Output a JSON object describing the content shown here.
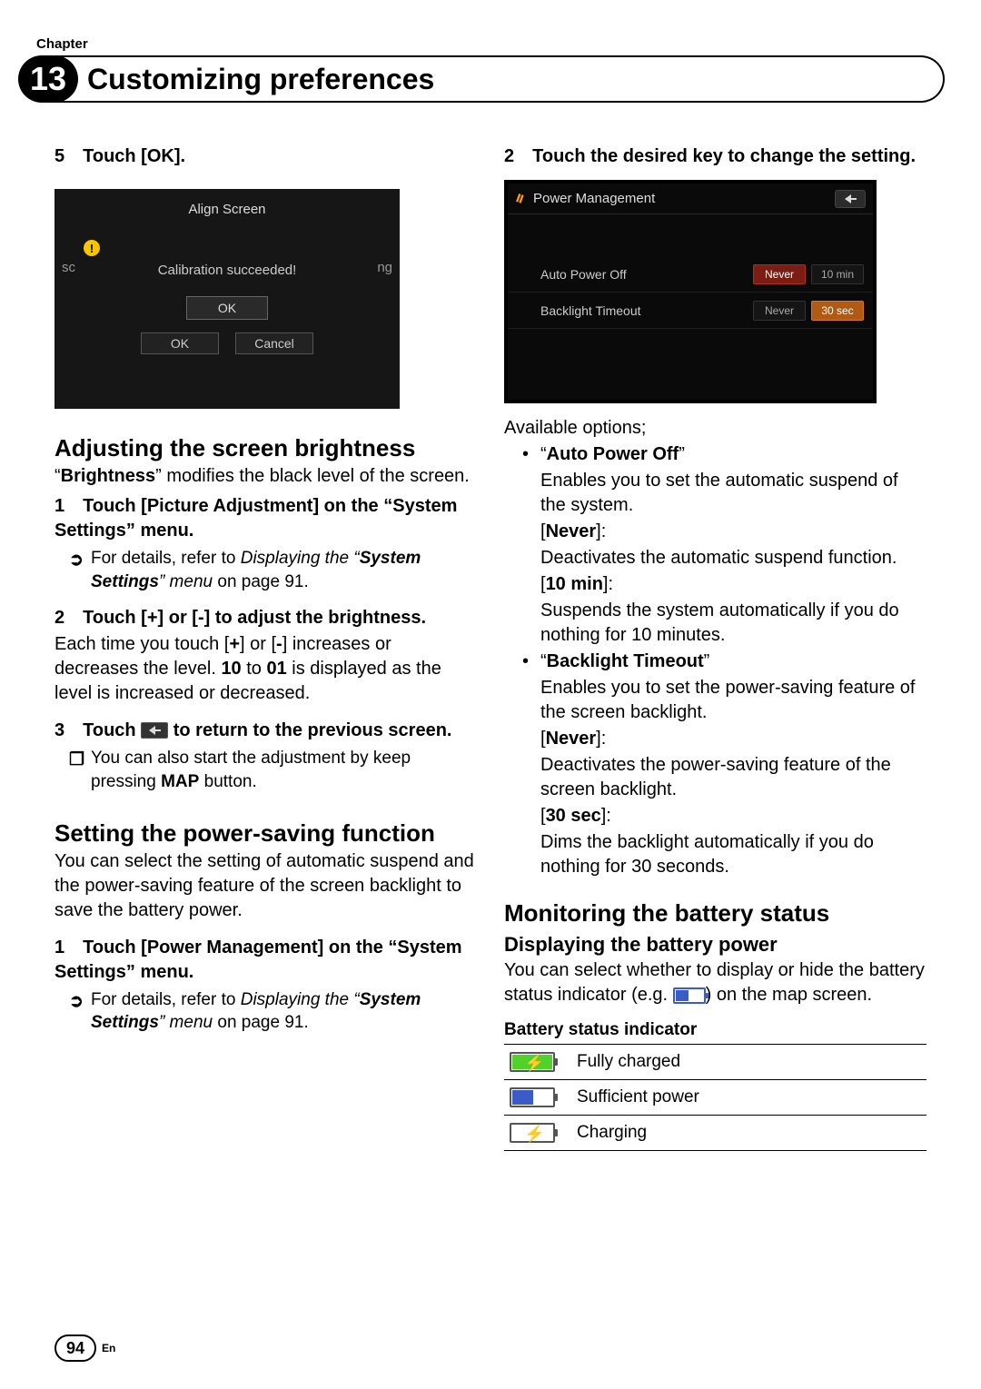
{
  "chapter_label": "Chapter",
  "chapter_num": "13",
  "chapter_title": "Customizing preferences",
  "page_num": "94",
  "lang": "En",
  "left": {
    "step5": "5 Touch [OK].",
    "shot1": {
      "title": "Align Screen",
      "left": "sc",
      "right": "ng",
      "msg": "Calibration succeeded!",
      "ok": "OK",
      "ok2": "OK",
      "cancel": "Cancel"
    },
    "h_brightness": "Adjusting the screen brightness",
    "p_brightness_1a": "“",
    "p_brightness_1b": "Brightness",
    "p_brightness_1c": "” modifies the black level of the screen.",
    "step_b1": "1 Touch [Picture Adjustment] on the “System Settings” menu.",
    "note_b1_pre": "For details, refer to ",
    "note_b1_it1": "Displaying the “",
    "note_b1_bold": "System Settings",
    "note_b1_it2": "” menu",
    "note_b1_post": " on page 91.",
    "step_b2": "2 Touch [+] or [-] to adjust the brightness.",
    "p_b2": "Each time you touch [",
    "p_b2_plus": "+",
    "p_b2_mid": "] or [",
    "p_b2_minus": "-",
    "p_b2_after": "] increases or decreases the level. ",
    "p_b2_10": "10",
    "p_b2_to": " to ",
    "p_b2_01": "01",
    "p_b2_tail": " is displayed as the level is increased or decreased.",
    "step_b3_pre": "3 Touch ",
    "step_b3_post": " to return to the previous screen.",
    "note_b3_pre": "You can also start the adjustment by keep pressing ",
    "note_b3_bold": "MAP",
    "note_b3_post": " button.",
    "h_power": "Setting the power-saving function",
    "p_power": "You can select the setting of automatic suspend and the power-saving feature of the screen backlight to save the battery power.",
    "step_p1": "1 Touch [Power Management] on the “System Settings” menu.",
    "note_p1_pre": "For details, refer to ",
    "note_p1_it1": "Displaying the “",
    "note_p1_bold": "System Settings",
    "note_p1_it2": "” menu",
    "note_p1_post": " on page 91."
  },
  "right": {
    "step2": "2 Touch the desired key to change the setting.",
    "shot2": {
      "title": "Power Management",
      "row1": {
        "label": "Auto Power Off",
        "opt1": "Never",
        "opt2": "10 min"
      },
      "row2": {
        "label": "Backlight Timeout",
        "opt1": "Never",
        "opt2": "30 sec"
      }
    },
    "avail": "Available options;",
    "apo_label": "“",
    "apo_bold": "Auto Power Off",
    "apo_close": "”",
    "apo_desc": "Enables you to set the automatic suspend of the system.",
    "never1_label": "[",
    "never1_bold": "Never",
    "never1_close": "]:",
    "never1_desc": "Deactivates the automatic suspend function.",
    "tenmin_label": "[",
    "tenmin_bold": "10 min",
    "tenmin_close": "]:",
    "tenmin_desc": "Suspends the system automatically if you do nothing for 10 minutes.",
    "bt_label": "“",
    "bt_bold": "Backlight Timeout",
    "bt_close": "”",
    "bt_desc": "Enables you to set the power-saving feature of the screen backlight.",
    "never2_label": "[",
    "never2_bold": "Never",
    "never2_close": "]:",
    "never2_desc": "Deactivates the power-saving feature of the screen backlight.",
    "sec30_label": "[",
    "sec30_bold": "30 sec",
    "sec30_close": "]:",
    "sec30_desc": "Dims the backlight automatically if you do nothing for 30 seconds.",
    "h_monitor": "Monitoring the battery status",
    "h_display": "Displaying the battery power",
    "p_display_pre": "You can select whether to display or hide the battery status indicator (e.g. ",
    "p_display_post": ") on the map screen.",
    "table_title": "Battery status indicator",
    "rows": {
      "r1": "Fully charged",
      "r2": "Sufficient power",
      "r3": "Charging"
    }
  }
}
